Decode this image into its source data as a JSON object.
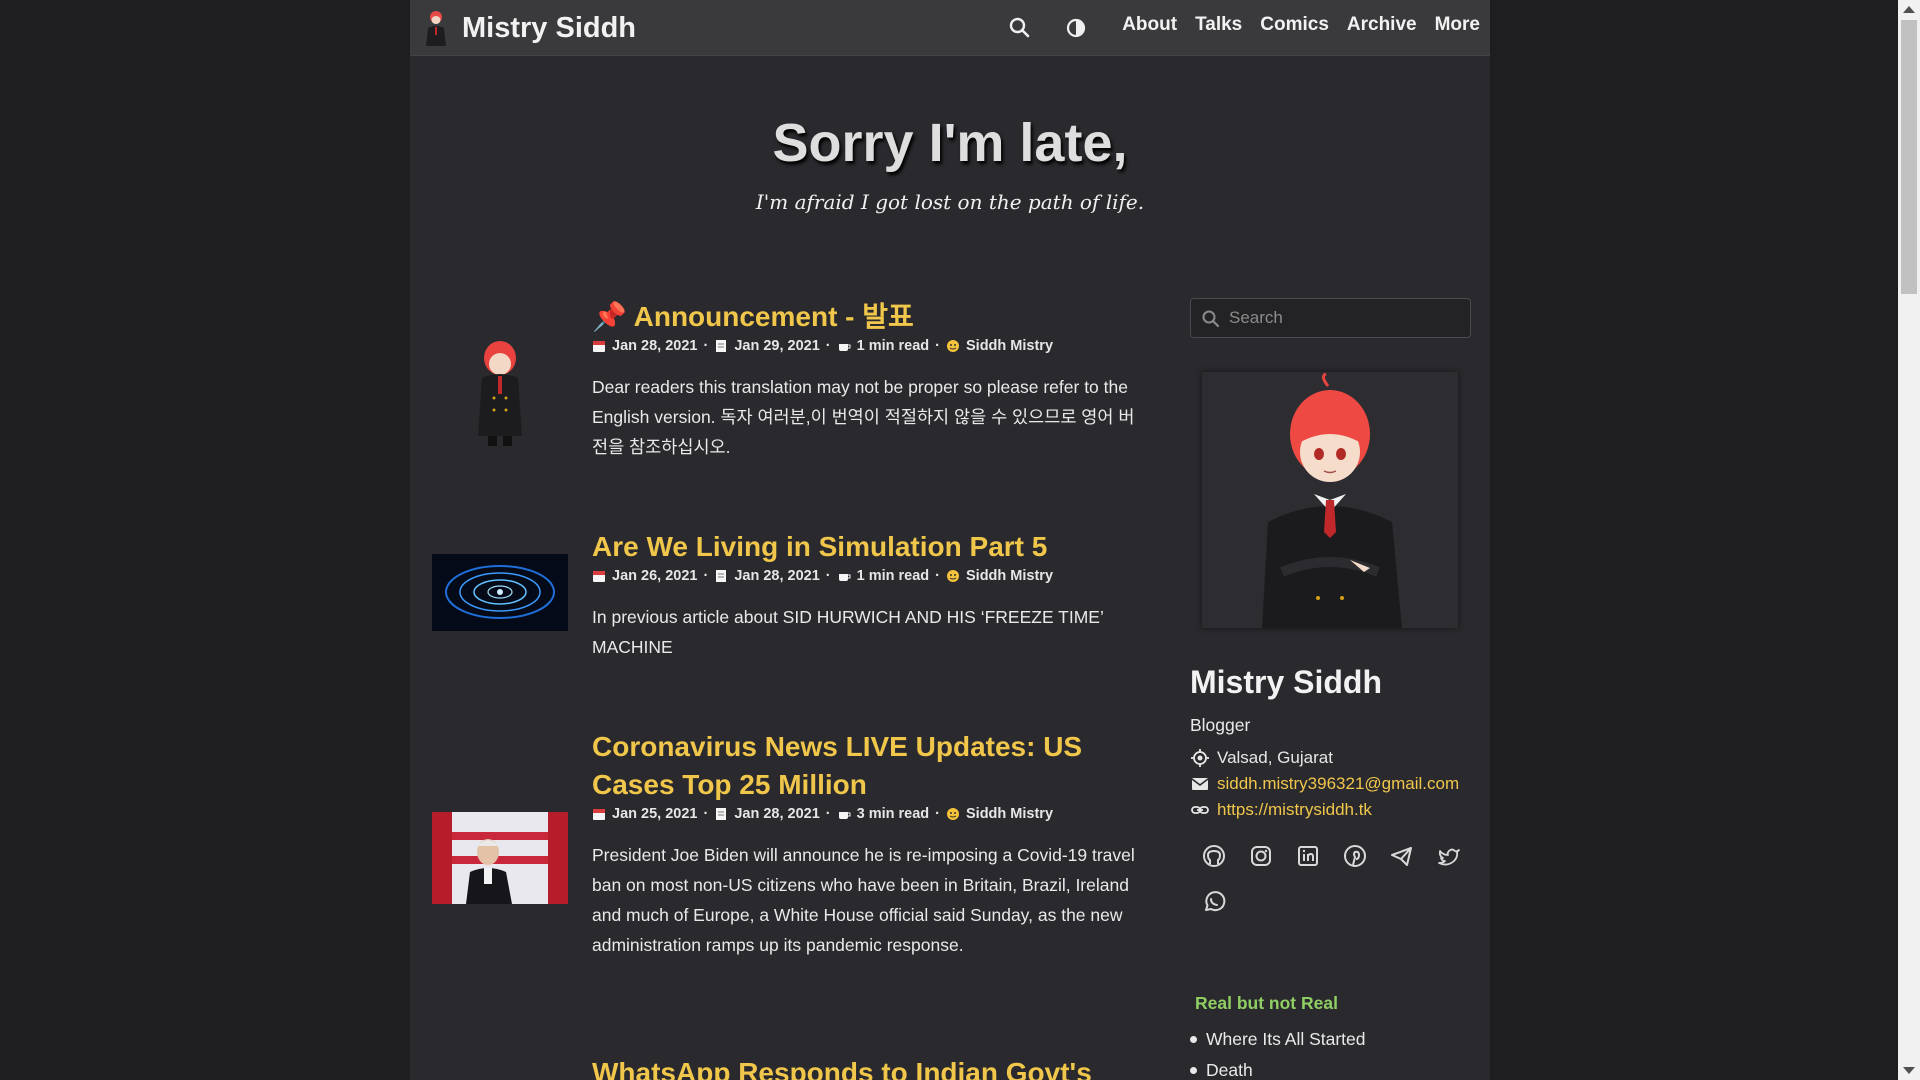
{
  "nav": {
    "brand": "Mistry Siddh",
    "icons": {
      "search": "search-icon",
      "theme": "contrast-icon"
    },
    "links": [
      "About",
      "Talks",
      "Comics",
      "Archive",
      "More"
    ]
  },
  "hero": {
    "title": "Sorry I'm late,",
    "subtitle": "I'm afraid I got lost on the path of life."
  },
  "posts": [
    {
      "pin": "📌",
      "title": "Announcement - 발표",
      "published": "Jan 28, 2021",
      "updated": "Jan 29, 2021",
      "read_time": "1 min read",
      "author": "Siddh Mistry",
      "summary": "Dear readers this translation may not be proper so please refer to the English version. 독자 여러분,이 번역이 적절하지 않을 수 있으므로 영어 버전을 참조하십시오."
    },
    {
      "title": "Are We Living in Simulation Part 5",
      "published": "Jan 26, 2021",
      "updated": "Jan 28, 2021",
      "read_time": "1 min read",
      "author": "Siddh Mistry",
      "summary": "In previous article about SID HURWICH AND HIS ‘FREEZE TIME’ MACHINE"
    },
    {
      "title": "Coronavirus News LIVE Updates: US Cases Top 25 Million",
      "published": "Jan 25, 2021",
      "updated": "Jan 28, 2021",
      "read_time": "3 min read",
      "author": "Siddh Mistry",
      "summary": "President Joe Biden will announce he is re-imposing a Covid-19 travel ban on most non-US citizens who have been in Britain, Brazil, Ireland and much of Europe, a White House official said Sunday, as the new administration ramps up its pandemic response."
    },
    {
      "title": "WhatsApp Responds to Indian Govt's"
    }
  ],
  "sidebar": {
    "search_placeholder": "Search",
    "name": "Mistry Siddh",
    "role": "Blogger",
    "location": "Valsad, Gujarat",
    "email": "siddh.mistry396321@gmail.com",
    "website": "https://mistrysiddh.tk",
    "socials": [
      "github-icon",
      "instagram-icon",
      "linkedin-icon",
      "pinterest-icon",
      "telegram-icon",
      "twitter-icon",
      "whatsapp-icon"
    ],
    "series_title": "Real but not Real",
    "series_items": [
      "Where Its All Started",
      "Death"
    ]
  },
  "colors": {
    "accent": "#f0c64b",
    "series": "#8fce62",
    "background": "#2a292d",
    "navbar": "#3a3a3d"
  }
}
